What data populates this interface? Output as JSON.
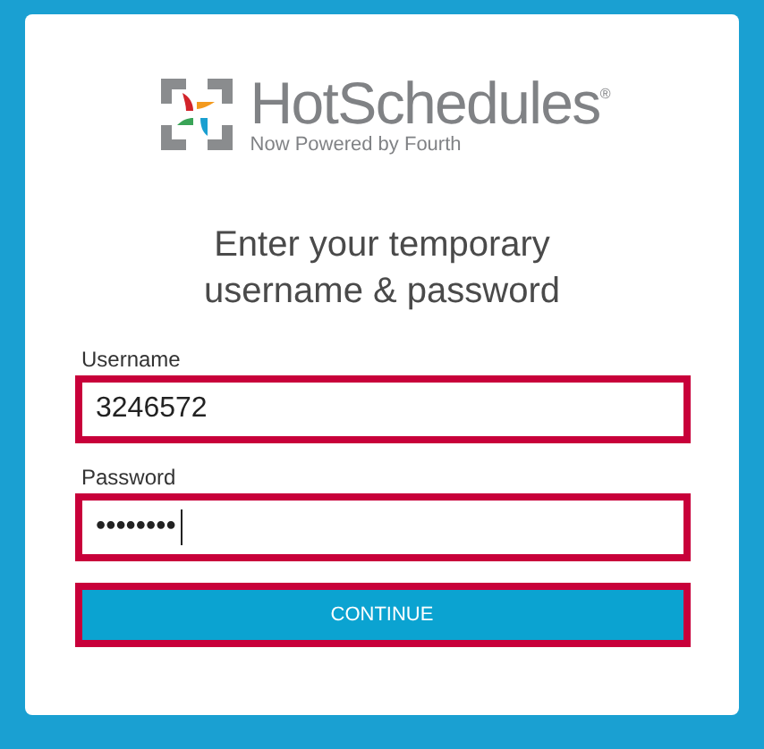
{
  "logo": {
    "name": "HotSchedules",
    "mark": "®",
    "tagline": "Now Powered by Fourth"
  },
  "heading": "Enter your temporary username & password",
  "fields": [
    {
      "label": "Username",
      "value": "3246572",
      "highlighted": true,
      "caret": false
    },
    {
      "label": "Password",
      "value": "••••••••",
      "highlighted": true,
      "caret": true
    }
  ],
  "button": {
    "label": "CONTINUE",
    "highlighted": true
  }
}
